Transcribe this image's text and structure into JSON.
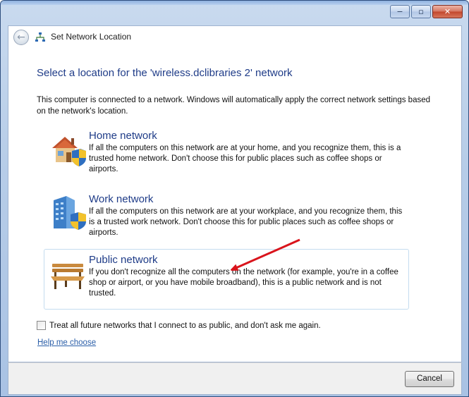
{
  "window": {
    "title": "Set Network Location",
    "caption_buttons": {
      "minimize": "−",
      "maximize": "▫",
      "close": "✕"
    }
  },
  "main": {
    "heading": "Select a location for the 'wireless.dclibraries  2' network",
    "intro": "This computer is connected to a network. Windows will automatically apply the correct network settings based on the network's location.",
    "options": [
      {
        "title": "Home network",
        "description": "If all the computers on this network are at your home, and you recognize them, this is a trusted home network.  Don't choose this for public places such as coffee shops or airports.",
        "icon": "house-shield-icon"
      },
      {
        "title": "Work network",
        "description": "If all the computers on this network are at your workplace, and you recognize them, this is a trusted work network.  Don't choose this for public places such as coffee shops or airports.",
        "icon": "office-building-shield-icon"
      },
      {
        "title": "Public network",
        "description": "If you don't recognize all the computers on the network (for example, you're in a coffee shop or airport, or you have mobile broadband), this is a public network and is not trusted.",
        "icon": "park-bench-icon",
        "highlighted": true
      }
    ],
    "checkbox_label": "Treat all future networks that I connect to as public, and don't ask me again.",
    "checkbox_checked": false,
    "help_link": "Help me choose"
  },
  "footer": {
    "cancel_label": "Cancel"
  },
  "colors": {
    "heading": "#1f3c88",
    "link": "#2a5ea8",
    "annotation_arrow": "#d9141c",
    "frame": "#b7cde8"
  }
}
